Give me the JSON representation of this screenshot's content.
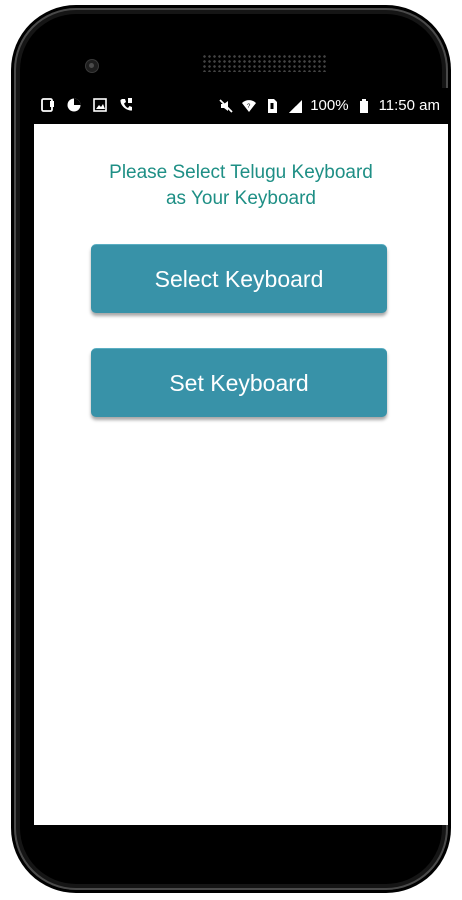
{
  "status_bar": {
    "battery_percent": "100%",
    "time": "11:50 am",
    "left_icons": [
      "notification-icon",
      "pie-chart-icon",
      "image-icon",
      "phone-icon"
    ],
    "right_icons": [
      "mute-icon",
      "wifi-icon",
      "sim-icon",
      "signal-icon",
      "battery-icon"
    ]
  },
  "main": {
    "instruction_line1": "Please Select Telugu Keyboard",
    "instruction_line2": "as Your Keyboard",
    "select_keyboard_label": "Select Keyboard",
    "set_keyboard_label": "Set Keyboard"
  },
  "colors": {
    "accent_text": "#1e8f85",
    "button_bg": "#3892a8",
    "status_bar_bg": "#000000"
  }
}
